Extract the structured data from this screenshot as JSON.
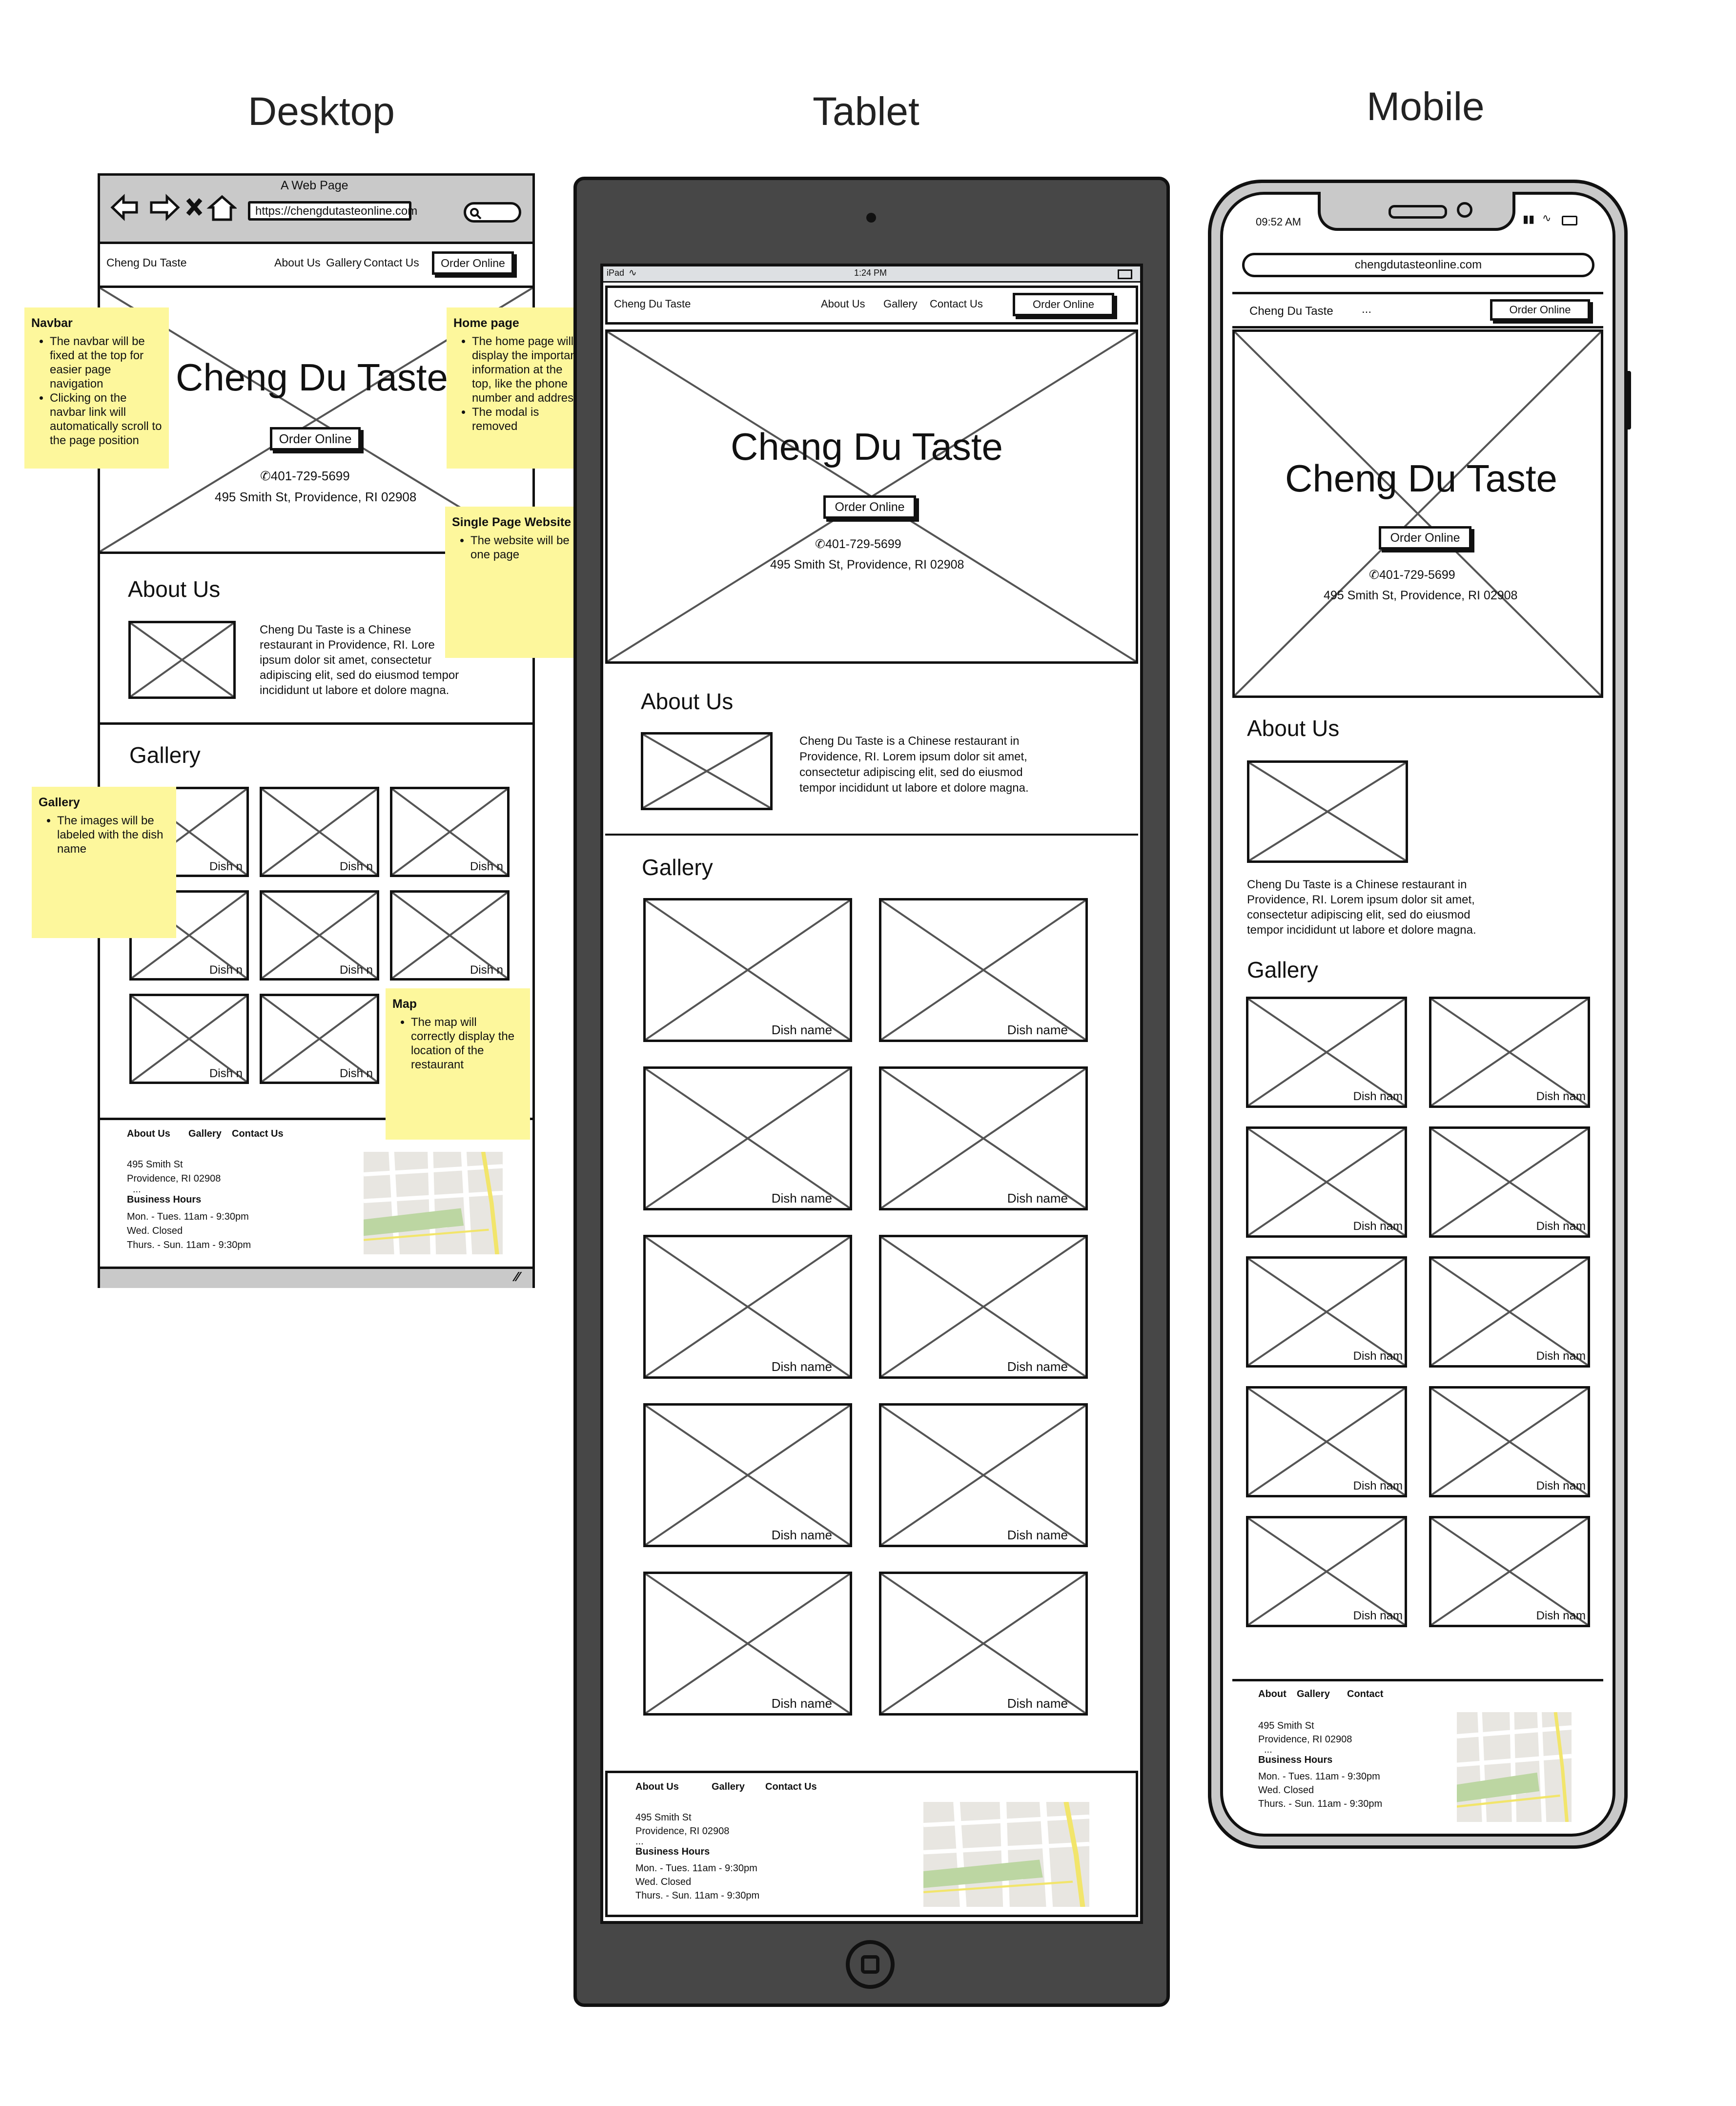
{
  "headings": {
    "desktop": "Desktop",
    "tablet": "Tablet",
    "mobile": "Mobile"
  },
  "site": {
    "name": "Cheng Du Taste",
    "brand": "Cheng Du Taste",
    "order_online": "Order Online",
    "nav": {
      "about": "About Us",
      "gallery": "Gallery",
      "contact": "Contact Us"
    },
    "phone": "401-729-5699",
    "address": "495 Smith St, Providence, RI 02908",
    "about_title": "About Us",
    "about_text": "Cheng Du Taste is a Chinese restaurant in Providence, RI. Lorem ipsum dolor sit amet, consectetur adipiscing elit, sed do eiusmod tempor incididunt ut labore et dolore magna.",
    "gallery_title": "Gallery",
    "dish_label": "Dish name",
    "footer": {
      "about": "About Us",
      "gallery": "Gallery",
      "contact": "Contact Us",
      "street": "495 Smith St",
      "city": "Providence, RI 02908",
      "ellipsis": "...",
      "hours_title": "Business Hours",
      "hours_1": "Mon. - Tues. 11am - 9:30pm",
      "hours_2": "Wed.  Closed",
      "hours_3": "Thurs. - Sun.  11am - 9:30pm"
    }
  },
  "desktop": {
    "browser_title": "A Web Page",
    "url": "https://chengdutasteonline.com",
    "hero_title": "Cheng Du Taste",
    "about_text_trunc": [
      "Cheng Du Taste is a Chinese",
      "restaurant in Providence, RI. Lore",
      "ipsum dolor sit amet, consectetur",
      "adipiscing elit, sed do eiusmod tempor",
      "incididunt ut labore et dolore magna."
    ],
    "dish_trunc": "Dish n"
  },
  "tablet": {
    "status_left": "iPad",
    "status_time": "1:24 PM",
    "about_lines": [
      "Cheng Du Taste is a Chinese restaurant in",
      "Providence, RI. Lorem ipsum dolor sit amet,",
      "consectetur adipiscing elit, sed do eiusmod",
      "tempor incididunt ut labore et dolore magna."
    ]
  },
  "mobile": {
    "status_time": "09:52 AM",
    "url": "chengdutasteonline.com",
    "menu": "...",
    "dish_trunc": "Dish nam",
    "footer_contact": "Contact",
    "footer_about": "About",
    "about_lines": [
      "Cheng Du Taste is a Chinese restaurant in",
      "Providence, RI. Lorem ipsum dolor sit amet,",
      "consectetur adipiscing elit, sed do eiusmod",
      "tempor incididunt ut labore et dolore magna."
    ]
  },
  "notes": {
    "navbar": {
      "title": "Navbar",
      "items": [
        "The navbar will be fixed at the top for easier page navigation",
        "Clicking on the navbar link will automatically scroll to the page position"
      ]
    },
    "home": {
      "title": "Home page",
      "items": [
        "The home page will display the important information at the top, like the phone number and address",
        "The modal is removed"
      ]
    },
    "single": {
      "title": "Single Page Website",
      "items": [
        "The website will be one page"
      ]
    },
    "gallery": {
      "title": "Gallery",
      "items": [
        "The images will be labeled with the dish name"
      ]
    },
    "map": {
      "title": "Map",
      "items": [
        "The map will correctly display the location of the restaurant"
      ]
    }
  },
  "colors": {
    "sticky": "#fdf79c",
    "ink": "#111111",
    "tablet_body": "#474747",
    "map_green": "#bcd6a2",
    "map_road": "#f2e56b"
  }
}
